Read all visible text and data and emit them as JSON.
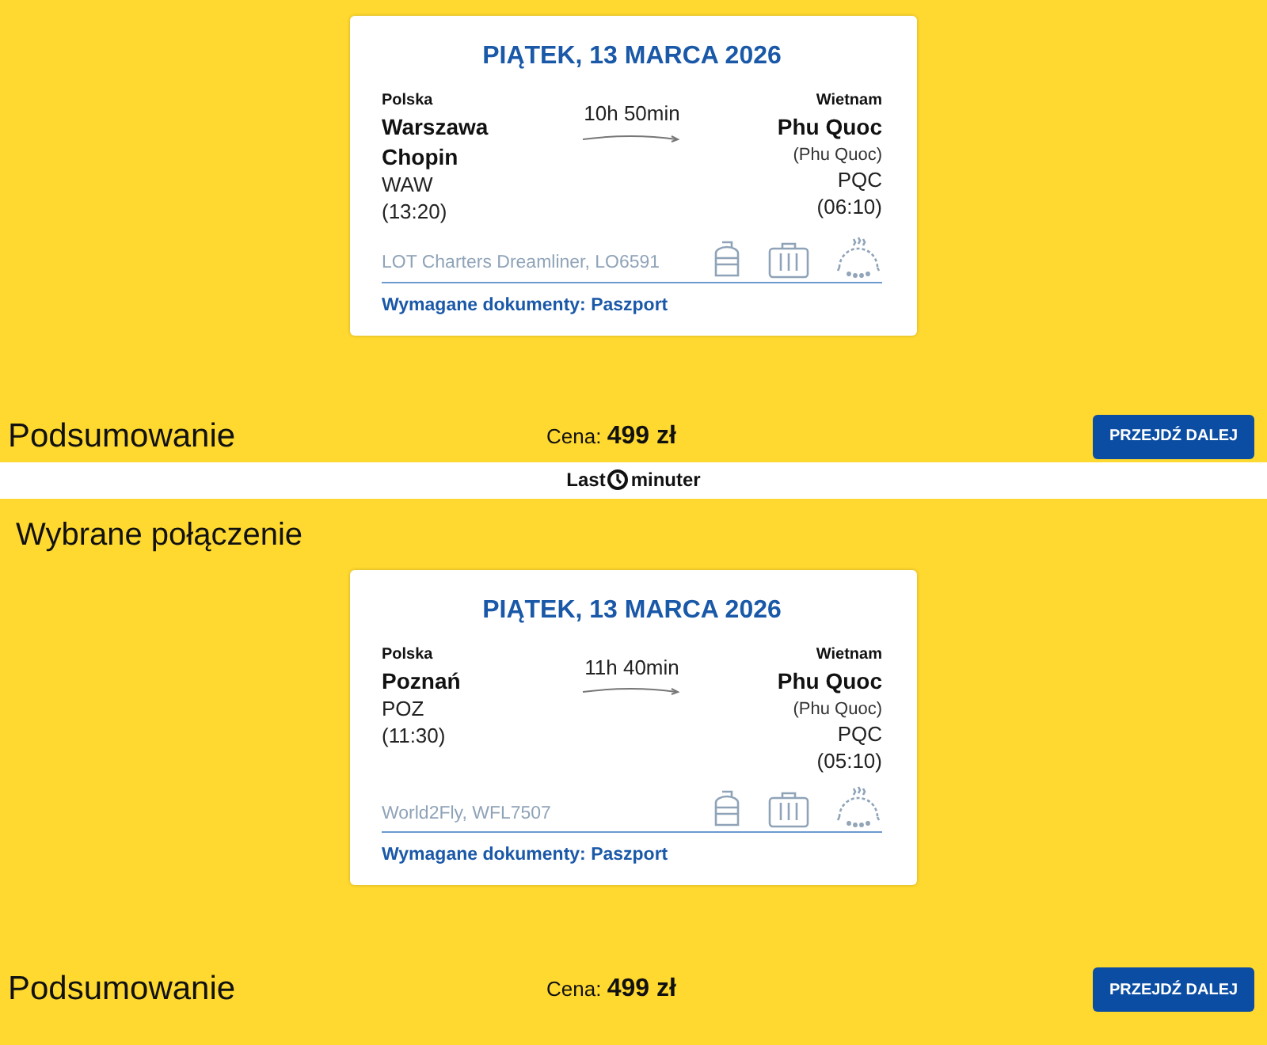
{
  "screens": [
    {
      "flight": {
        "date": "PIĄTEK, 13 MARCA 2026",
        "origin": {
          "country": "Polska",
          "city": "Warszawa Chopin",
          "code": "WAW",
          "time": "(13:20)"
        },
        "duration": "10h 50min",
        "destination": {
          "country": "Wietnam",
          "city": "Phu Quoc",
          "airport": "(Phu Quoc)",
          "code": "PQC",
          "time": "(06:10)"
        },
        "carrier": "LOT Charters Dreamliner, LO6591",
        "documents": "Wymagane dokumenty: Paszport"
      },
      "summary": {
        "title": "Podsumowanie",
        "price_label": "Cena:",
        "price": "499 zł",
        "button": "PRZEJDŹ DALEJ"
      }
    },
    {
      "logo": {
        "left": "Last",
        "right": "minuter"
      },
      "heading": "Wybrane połączenie",
      "flight": {
        "date": "PIĄTEK, 13 MARCA 2026",
        "origin": {
          "country": "Polska",
          "city": "Poznań",
          "code": "POZ",
          "time": "(11:30)"
        },
        "duration": "11h 40min",
        "destination": {
          "country": "Wietnam",
          "city": "Phu Quoc",
          "airport": "(Phu Quoc)",
          "code": "PQC",
          "time": "(05:10)"
        },
        "carrier": "World2Fly, WFL7507",
        "documents": "Wymagane dokumenty: Paszport"
      },
      "summary": {
        "title": "Podsumowanie",
        "price_label": "Cena:",
        "price": "499 zł",
        "button": "PRZEJDŹ DALEJ"
      }
    }
  ]
}
